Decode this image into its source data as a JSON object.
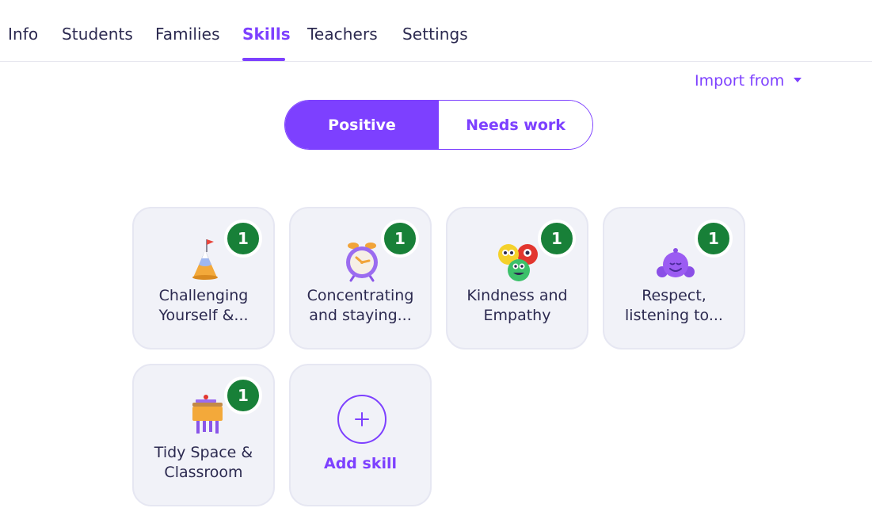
{
  "tabs": [
    {
      "label": "Info"
    },
    {
      "label": "Students"
    },
    {
      "label": "Families"
    },
    {
      "label": "Skills",
      "active": true
    },
    {
      "label": "Teachers"
    },
    {
      "label": "Settings"
    }
  ],
  "import_label": "Import from",
  "toggle": {
    "positive": "Positive",
    "needs_work": "Needs work",
    "selected": "Positive"
  },
  "skills": [
    {
      "label": "Challenging Yourself &...",
      "count": "1",
      "icon": "mountain-flag-icon"
    },
    {
      "label": "Concentrating and staying...",
      "count": "1",
      "icon": "alarm-clock-icon"
    },
    {
      "label": "Kindness and Empathy",
      "count": "1",
      "icon": "monsters-group-icon"
    },
    {
      "label": "Respect, listening to...",
      "count": "1",
      "icon": "purple-monster-icon"
    },
    {
      "label": "Tidy Space & Classroom",
      "count": "1",
      "icon": "school-desk-icon"
    }
  ],
  "add_skill_label": "Add skill",
  "colors": {
    "accent": "#7d40ff",
    "badge": "#188038",
    "card_bg": "#f1f2f8"
  }
}
